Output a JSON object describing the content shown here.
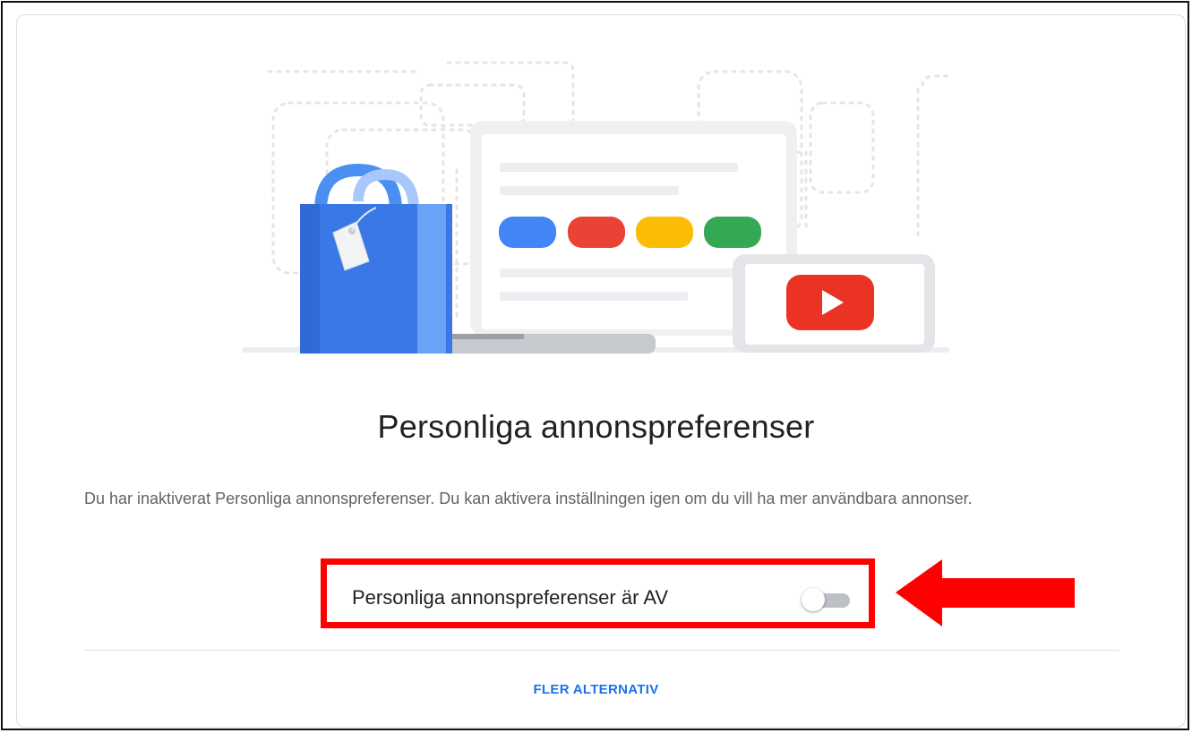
{
  "page": {
    "title": "Personliga annonspreferenser",
    "description": "Du har inaktiverat Personliga annonspreferenser. Du kan aktivera inställningen igen om du vill ha mer användbara annonser.",
    "toggle": {
      "label": "Personliga annonspreferenser är AV",
      "state": "off"
    },
    "more_options_label": "FLER ALTERNATIV"
  },
  "colors": {
    "blue": "#4285f4",
    "red": "#ea4335",
    "yellow": "#fbbc04",
    "green": "#34a853",
    "youtube_red": "#ea3323",
    "highlight": "#ff0000",
    "link": "#1a73e8"
  },
  "icons": {
    "illustration": "shopping-bag-laptop-phone-illustration",
    "arrow": "arrow-left-icon",
    "play": "youtube-play-icon"
  }
}
